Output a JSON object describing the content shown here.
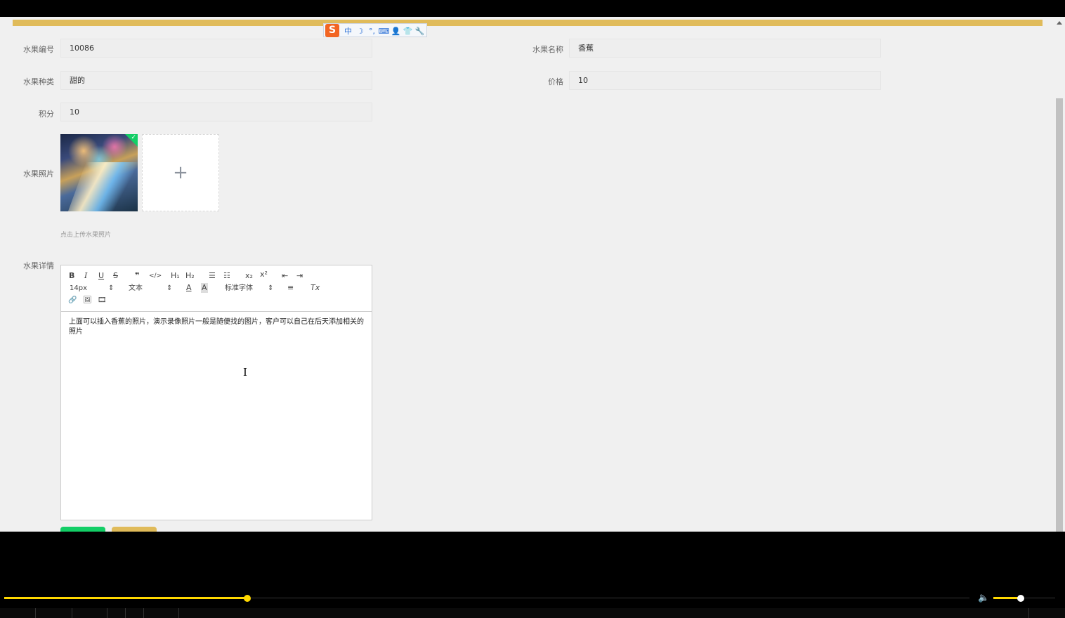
{
  "form": {
    "fruit_id_label": "水果编号",
    "fruit_id_value": "10086",
    "fruit_name_label": "水果名称",
    "fruit_name_value": "香蕉",
    "fruit_type_label": "水果种类",
    "fruit_type_value": "甜的",
    "price_label": "价格",
    "price_value": "10",
    "points_label": "积分",
    "points_value": "10",
    "photo_label": "水果照片",
    "photo_tip": "点击上传水果照片",
    "detail_label": "水果详情"
  },
  "editor": {
    "toolbar": {
      "bold": "B",
      "italic": "I",
      "underline": "U",
      "strike": "S",
      "quote": "❞",
      "code": "</>",
      "h1": "H₁",
      "h2": "H₂",
      "ordered_list": "☰",
      "bullet_list": "☷",
      "subscript": "x₂",
      "superscript": "x²",
      "outdent": "⇤",
      "indent": "⇥",
      "size": "14px",
      "header": "文本",
      "color": "A",
      "background": "A",
      "font": "标准字体",
      "align": "≡",
      "clean": "Tx",
      "link": "🔗",
      "image": "🖼",
      "video": "🎞"
    },
    "content": "上面可以插入香蕉的照片，演示录像照片一般是随便找的图片，客户可以自己在后天添加相关的照片"
  },
  "ime": {
    "logo": "S",
    "items": [
      "中",
      "☽",
      "°,",
      "⌨",
      "👤",
      "👕",
      "🔧"
    ]
  },
  "player": {
    "progress_fraction": 0.252,
    "volume_fraction": 0.44
  },
  "colors": {
    "accent_bar": "#e0bb5a",
    "success": "#13ce66",
    "player_accent": "#ffd800"
  }
}
